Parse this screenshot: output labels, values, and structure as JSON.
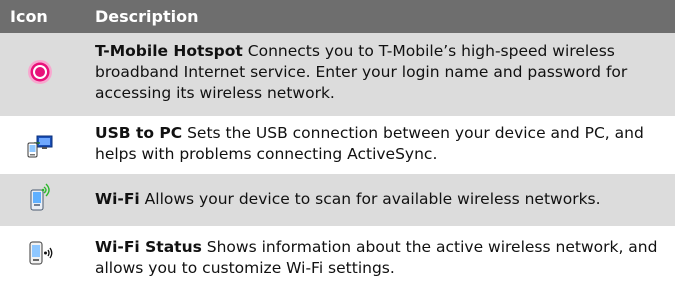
{
  "table": {
    "header": {
      "icon": "Icon",
      "description": "Description"
    },
    "rows": [
      {
        "icon": "hotspot-icon",
        "term": "T-Mobile Hotspot",
        "text": "  Connects you to T-Mobile’s high-speed wireless broadband Internet service. Enter your login name and password for accessing its wireless network."
      },
      {
        "icon": "usb-to-pc-icon",
        "term": "USB to PC",
        "text": " Sets the USB connection between your device and PC, and helps with problems connecting ActiveSync."
      },
      {
        "icon": "wifi-icon",
        "term": "Wi-Fi",
        "text": "  Allows your device to scan for available wireless networks."
      },
      {
        "icon": "wifi-status-icon",
        "term": "Wi-Fi Status",
        "text": "  Shows information about the active wireless network, and allows you to customize Wi-Fi settings."
      }
    ]
  },
  "colors": {
    "header_bg": "#6e6e6e",
    "shaded_row_bg": "#dcdcdc",
    "accent_pink": "#e8127a"
  }
}
